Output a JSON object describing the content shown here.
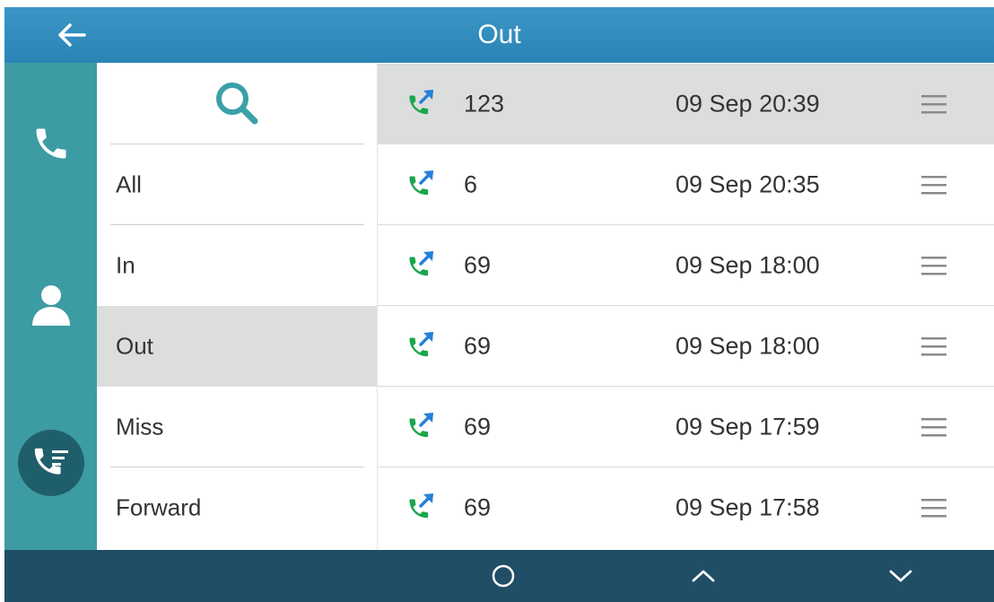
{
  "header": {
    "title": "Out"
  },
  "left_nav": {
    "icons": [
      "phone-icon",
      "contacts-icon",
      "call-history-icon"
    ]
  },
  "filters": {
    "search_icon": "search-icon",
    "items": [
      {
        "label": "All",
        "active": false
      },
      {
        "label": "In",
        "active": false
      },
      {
        "label": "Out",
        "active": true
      },
      {
        "label": "Miss",
        "active": false
      },
      {
        "label": "Forward",
        "active": false
      }
    ]
  },
  "calls": [
    {
      "number": "123",
      "time": "09 Sep 20:39",
      "selected": true
    },
    {
      "number": "6",
      "time": "09 Sep 20:35",
      "selected": false
    },
    {
      "number": "69",
      "time": "09 Sep 18:00",
      "selected": false
    },
    {
      "number": "69",
      "time": "09 Sep 18:00",
      "selected": false
    },
    {
      "number": "69",
      "time": "09 Sep 17:59",
      "selected": false
    },
    {
      "number": "69",
      "time": "09 Sep 17:58",
      "selected": false
    }
  ],
  "bottom_bar": {
    "buttons": [
      "circle-icon",
      "chevron-up-icon",
      "chevron-down-icon"
    ]
  },
  "colors": {
    "header": "#2a83b5",
    "sidebar": "#3d9ba3",
    "bottom_bar": "#1f4e66",
    "selected_row": "#dcdddd",
    "call_green": "#1aa64b",
    "arrow_blue": "#2680d9"
  }
}
